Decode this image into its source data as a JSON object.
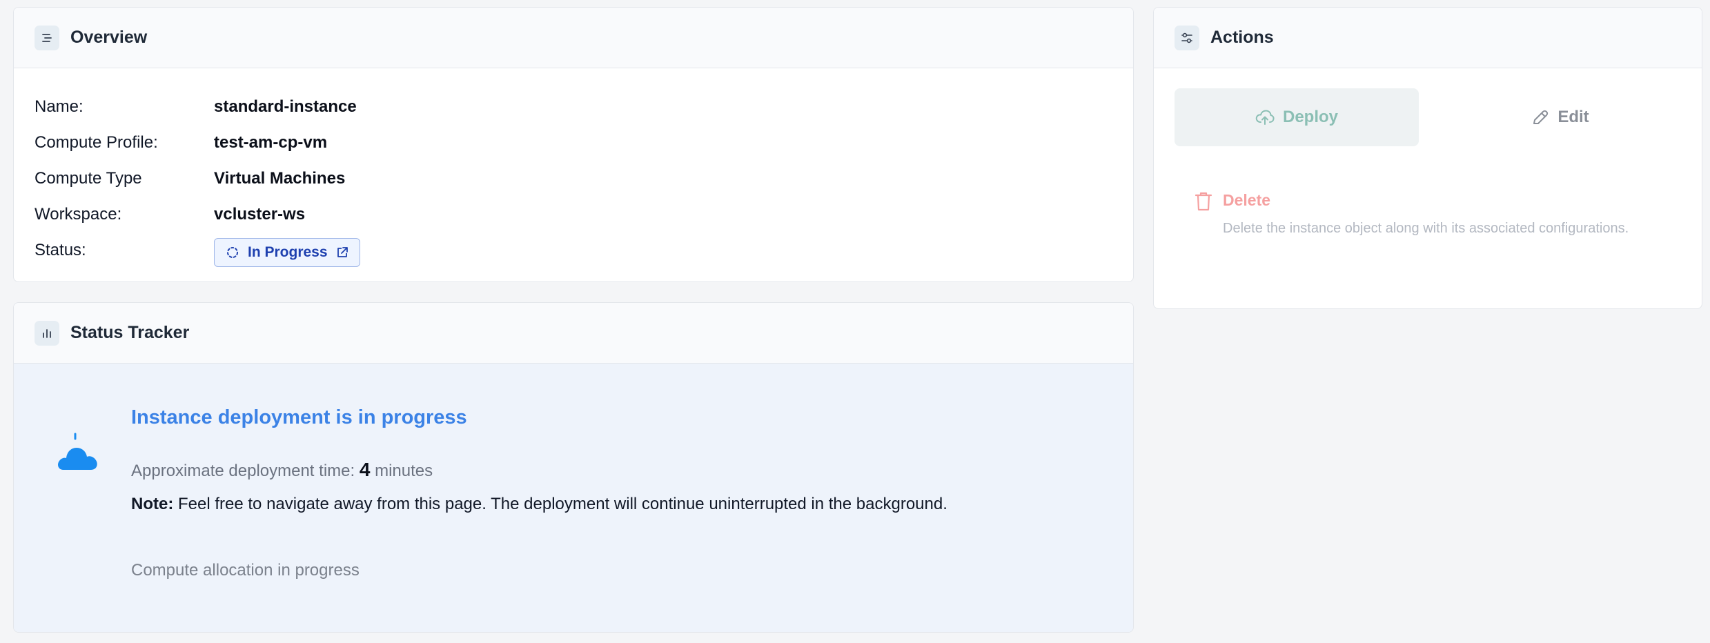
{
  "overview": {
    "title": "Overview",
    "icon": "list-icon",
    "fields": [
      {
        "label": "Name:",
        "value": "standard-instance"
      },
      {
        "label": "Compute Profile:",
        "value": "test-am-cp-vm"
      },
      {
        "label": "Compute Type",
        "value": "Virtual Machines"
      },
      {
        "label": "Workspace:",
        "value": "vcluster-ws"
      }
    ],
    "status_label": "Status:",
    "status_value": "In Progress"
  },
  "tracker": {
    "title": "Status Tracker",
    "icon": "bar-chart-icon",
    "heading": "Instance deployment is in progress",
    "time_prefix": "Approximate deployment time:",
    "time_value": "4",
    "time_unit": "minutes",
    "note_label": "Note:",
    "note_text": "Feel free to navigate away from this page. The deployment will continue uninterrupted in the background.",
    "step": "Compute allocation in progress"
  },
  "actions": {
    "title": "Actions",
    "icon": "sliders-icon",
    "deploy_label": "Deploy",
    "edit_label": "Edit",
    "delete_label": "Delete",
    "delete_desc": "Delete the instance object along with its associated configurations."
  },
  "colors": {
    "accent_blue": "#3b82e6",
    "deploy_text": "#8bbfb4",
    "delete_text": "#f5a0a0",
    "tracker_bg": "#eef3fb"
  }
}
